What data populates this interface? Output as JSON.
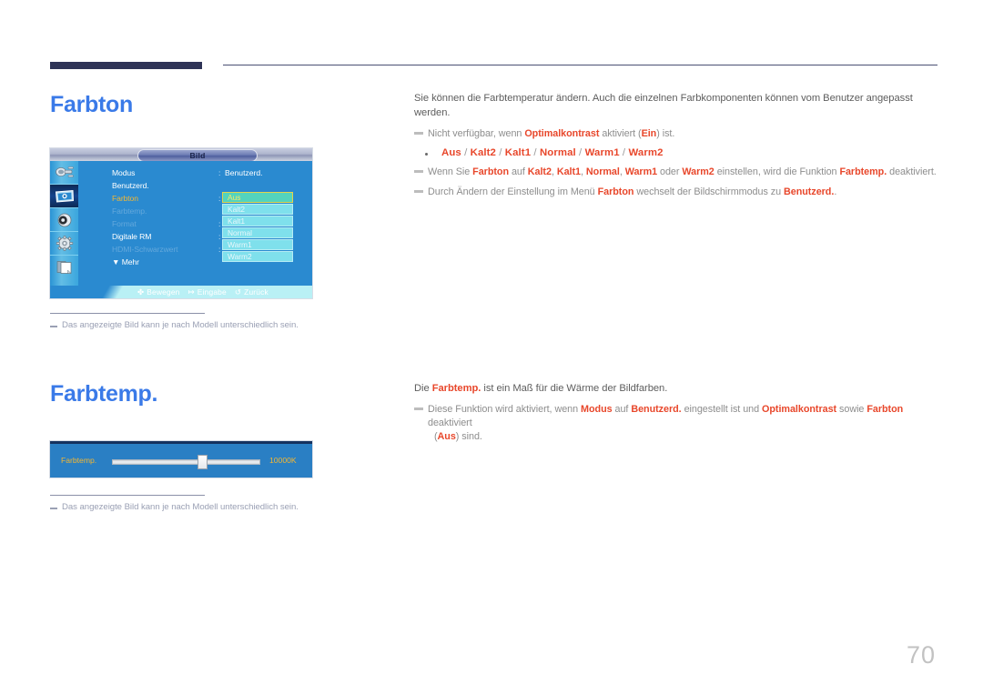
{
  "document": {
    "page_number": "70"
  },
  "sections": [
    {
      "heading": "Farbton"
    },
    {
      "heading": "Farbtemp."
    }
  ],
  "headings": {
    "farbton": "Farbton",
    "farbtemp": "Farbtemp."
  },
  "farbton_text": {
    "intro": "Sie können die Farbtemperatur ändern. Auch die einzelnen Farbkomponenten können vom Benutzer angepasst werden.",
    "note1_a": "Nicht verfügbar, wenn ",
    "note1_b": "Optimalkontrast",
    "note1_c": " aktiviert (",
    "note1_d": "Ein",
    "note1_e": ") ist.",
    "options_line": "Aus / Kalt2 / Kalt1 / Normal / Warm1 / Warm2",
    "options": [
      "Aus",
      "Kalt2",
      "Kalt1",
      "Normal",
      "Warm1",
      "Warm2"
    ],
    "note2_a": "Wenn Sie ",
    "note2_b": "Farbton",
    "note2_c": " auf ",
    "note2_d": "Kalt2",
    "note2_e": ", ",
    "note2_f": "Kalt1",
    "note2_g": ", ",
    "note2_h": "Normal",
    "note2_i": ", ",
    "note2_j": "Warm1",
    "note2_k": " oder ",
    "note2_l": "Warm2",
    "note2_m": " einstellen, wird die Funktion ",
    "note2_n": "Farbtemp.",
    "note2_o": " deaktiviert.",
    "note3_a": "Durch Ändern der Einstellung im Menü ",
    "note3_b": "Farbton",
    "note3_c": " wechselt der Bildschirmmodus zu ",
    "note3_d": "Benutzerd.",
    "note3_e": "."
  },
  "farbtemp_text": {
    "intro_a": "Die ",
    "intro_b": "Farbtemp.",
    "intro_c": " ist ein Maß für die Wärme der Bildfarben.",
    "note1_a": "Diese Funktion wird aktiviert, wenn ",
    "note1_b": "Modus",
    "note1_c": " auf ",
    "note1_d": "Benutzerd.",
    "note1_e": " eingestellt ist und ",
    "note1_f": "Optimalkontrast",
    "note1_g": " sowie ",
    "note1_h": "Farbton",
    "note1_i": " deaktiviert",
    "note1_j": "(",
    "note1_k": "Aus",
    "note1_l": ") sind."
  },
  "figure_notes": {
    "note_1": "Das angezeigte Bild kann je nach Modell unterschiedlich sein.",
    "note_2": "Das angezeigte Bild kann je nach Modell unterschiedlich sein."
  },
  "osd": {
    "title": "Bild",
    "sidebar_icons": [
      "input-plug-icon",
      "picture-display-icon",
      "sound-speaker-icon",
      "settings-gear-icon",
      "page-document-icon"
    ],
    "menu_items": [
      {
        "label": "Modus",
        "state": "normal",
        "colon": ":",
        "value": "Benutzerd."
      },
      {
        "label": "Benutzerd.",
        "state": "normal",
        "colon": "",
        "value": ""
      },
      {
        "label": "Farbton",
        "state": "selected",
        "colon": ":",
        "value": ""
      },
      {
        "label": "Farbtemp.",
        "state": "dim",
        "colon": "",
        "value": ""
      },
      {
        "label": "Format",
        "state": "dim",
        "colon": ":",
        "value": ""
      },
      {
        "label": "Digitale RM",
        "state": "normal",
        "colon": ":",
        "value": ""
      },
      {
        "label": "HDMI-Schwarzwert",
        "state": "dim",
        "colon": ":",
        "value": ""
      },
      {
        "label": "▼ Mehr",
        "state": "normal",
        "colon": "",
        "value": ""
      }
    ],
    "dropdown": [
      {
        "label": "Aus",
        "active": true
      },
      {
        "label": "Kalt2",
        "active": false
      },
      {
        "label": "Kalt1",
        "active": false
      },
      {
        "label": "Normal",
        "active": false
      },
      {
        "label": "Warm1",
        "active": false
      },
      {
        "label": "Warm2",
        "active": false
      }
    ],
    "footer": {
      "move_icon": "✤",
      "move_label": "Bewegen",
      "enter_icon": "↦",
      "enter_label": "Eingabe",
      "back_icon": "↺",
      "back_label": "Zurück"
    }
  },
  "slider_figure": {
    "label": "Farbtemp.",
    "value": "10000K",
    "knob_percent": 58
  },
  "colors": {
    "heading_blue": "#3a7ae8",
    "highlight_red": "#e8472b",
    "rule_navy": "#2e3356",
    "osd_blue": "#2a8ad0",
    "osd_selected_amber": "#f5b731",
    "dropdown_cyan": "#7fe0ec",
    "dropdown_active": "#53d4bd",
    "page_number_gray": "#c2c2c2"
  }
}
